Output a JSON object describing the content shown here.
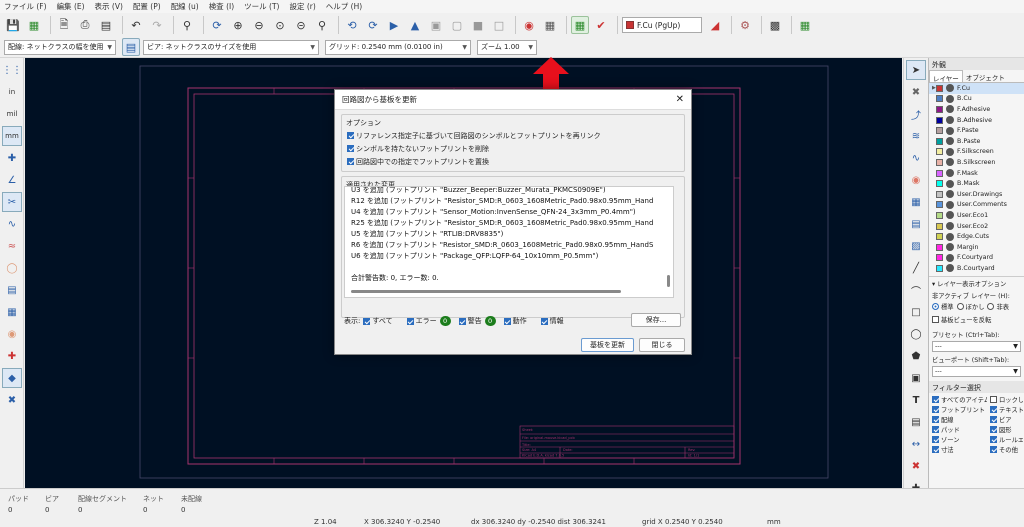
{
  "menu": [
    "ファイル (F)",
    "編集 (E)",
    "表示 (V)",
    "配置 (P)",
    "配線 (u)",
    "検査 (I)",
    "ツール (T)",
    "設定 (r)",
    "ヘルプ (H)"
  ],
  "toolbar": {
    "layer_select": "F.Cu (PgUp)",
    "icons": [
      "save-icon",
      "board-setup-icon",
      "new-icon",
      "print-icon",
      "plot-icon",
      "undo-icon",
      "redo-icon",
      "find-icon",
      "refresh-icon",
      "zoom-in-icon",
      "zoom-out-icon",
      "zoom-fit-icon",
      "zoom-objects-icon",
      "zoom-selection-icon",
      "rotate-ccw-icon",
      "rotate-cw-icon",
      "flip-icon",
      "mirror-icon",
      "group-icon",
      "ungroup-icon",
      "lock-icon",
      "unlock-icon",
      "netlist-icon",
      "footprint-library-icon",
      "update-pcb-icon",
      "drc-icon",
      "layer-pair-icon",
      "scripting-icon",
      "python-icon",
      "plugin-icon"
    ]
  },
  "toolbar2": {
    "track_width": "配線: ネットクラスの幅を使用",
    "via_size": "ビア: ネットクラスのサイズを使用",
    "grid": "グリッド: 0.2540 mm (0.0100 in)",
    "zoom": "ズーム 1.00"
  },
  "left_toolbar": [
    "grid-icon",
    "inch-icon",
    "mil-icon",
    "mm-icon",
    "cursor-icon",
    "polar-icon",
    "ratsnest-icon",
    "curved-ratsnest-icon",
    "track-outline-icon",
    "via-outline-icon",
    "pad-outline-icon",
    "zone-outline-icon",
    "zone-fill-icon",
    "highlight-net-icon",
    "layers-icon",
    "tool-icon"
  ],
  "left_toolbar_labels": {
    "inch": "in",
    "mil": "mil",
    "mm": "mm"
  },
  "right_toolbar": [
    "select-icon",
    "highlight-net-icon",
    "route-track-icon",
    "route-diff-pair-icon",
    "tune-length-icon",
    "add-footprint-icon",
    "add-via-icon",
    "add-zone-icon",
    "add-rule-area-icon",
    "add-line-icon",
    "add-arc-icon",
    "add-rectangle-icon",
    "add-circle-icon",
    "add-polygon-icon",
    "add-image-icon",
    "add-text-icon",
    "add-textbox-icon",
    "add-dimension-icon",
    "delete-icon",
    "set-origin-icon",
    "measure-icon"
  ],
  "appearance": {
    "title": "外観",
    "tabs": [
      "レイヤー",
      "オブジェクト"
    ],
    "layers": [
      {
        "name": "F.Cu",
        "color": "#c83434",
        "selected": true
      },
      {
        "name": "B.Cu",
        "color": "#4d7fc4"
      },
      {
        "name": "F.Adhesive",
        "color": "#8e1788"
      },
      {
        "name": "B.Adhesive",
        "color": "#00009e"
      },
      {
        "name": "F.Paste",
        "color": "#b4a0a0"
      },
      {
        "name": "B.Paste",
        "color": "#00a0a0"
      },
      {
        "name": "F.Silkscreen",
        "color": "#f2eda1"
      },
      {
        "name": "B.Silkscreen",
        "color": "#e8b2a7"
      },
      {
        "name": "F.Mask",
        "color": "#d864ff"
      },
      {
        "name": "B.Mask",
        "color": "#02ffee"
      },
      {
        "name": "User.Drawings",
        "color": "#c2c2c2"
      },
      {
        "name": "User.Comments",
        "color": "#5994dc"
      },
      {
        "name": "User.Eco1",
        "color": "#b4db88"
      },
      {
        "name": "User.Eco2",
        "color": "#d8c852"
      },
      {
        "name": "Edge.Cuts",
        "color": "#d0d254"
      },
      {
        "name": "Margin",
        "color": "#ff26e2"
      },
      {
        "name": "F.Courtyard",
        "color": "#ff26e2"
      },
      {
        "name": "B.Courtyard",
        "color": "#26e9ff"
      }
    ],
    "display_options": "レイヤー表示オプション",
    "inactive_label": "非アクティブ レイヤー (H):",
    "inactive_options": [
      "標準",
      "ぼかし",
      "非表"
    ],
    "flip_board": "基板ビューを反転",
    "presets_label": "プリセット (Ctrl+Tab):",
    "presets_value": "---",
    "viewports_label": "ビューポート (Shift+Tab):",
    "viewports_value": "---"
  },
  "filter": {
    "title": "フィルター選択",
    "items": [
      {
        "label": "すべてのアイテム",
        "checked": true
      },
      {
        "label": "ロックし",
        "checked": false
      },
      {
        "label": "フットプリント",
        "checked": true
      },
      {
        "label": "テキスト",
        "checked": true
      },
      {
        "label": "配線",
        "checked": true
      },
      {
        "label": "ビア",
        "checked": true
      },
      {
        "label": "パッド",
        "checked": true
      },
      {
        "label": "図形",
        "checked": true
      },
      {
        "label": "ゾーン",
        "checked": true
      },
      {
        "label": "ルールエ",
        "checked": true
      },
      {
        "label": "寸法",
        "checked": true
      },
      {
        "label": "その他",
        "checked": true
      }
    ]
  },
  "status": {
    "labels": [
      "パッド",
      "ビア",
      "配線セグメント",
      "ネット",
      "未配線"
    ],
    "values": [
      "0",
      "0",
      "0",
      "0",
      "0"
    ],
    "zoom": "Z 1.04",
    "xy": "X 306.3240  Y -0.2540",
    "dxdy": "dx 306.3240  dy -0.2540  dist 306.3241",
    "grid": "grid X 0.2540  Y 0.2540",
    "units": "mm"
  },
  "titleblock": {
    "sheet": "Sheet:",
    "file": "File: original-mouse.kicad_pcb",
    "title": "Title:",
    "size": "Size: A4",
    "date": "Date:",
    "rev": "Rev:",
    "kicad": "KiCad E.D.A.  kicad 7.0.5",
    "id": "Id: 1/1"
  },
  "dialog": {
    "title": "回路図から基板を更新",
    "options_title": "オプション",
    "options": [
      {
        "label": "リファレンス指定子に基づいて回路図のシンボルとフットプリントを再リンク",
        "checked": true
      },
      {
        "label": "シンボルを持たないフットプリントを削除",
        "checked": true
      },
      {
        "label": "回路図中での指定でフットプリントを置換",
        "checked": true
      }
    ],
    "changes_title": "適用された変更",
    "messages": [
      "U3 を追加 (フットプリント \"Buzzer_Beeper:Buzzer_Murata_PKMCS0909E\")",
      "R12 を追加 (フットプリント \"Resistor_SMD:R_0603_1608Metric_Pad0.98x0.95mm_Hand",
      "U4 を追加 (フットプリント \"Sensor_Motion:InvenSense_QFN-24_3x3mm_P0.4mm\")",
      "R25 を追加 (フットプリント \"Resistor_SMD:R_0603_1608Metric_Pad0.98x0.95mm_Hand",
      "U5 を追加 (フットプリント \"RTLIB:DRV8835\")",
      "R6 を追加 (フットプリント \"Resistor_SMD:R_0603_1608Metric_Pad0.98x0.95mm_HandS",
      "U6 を追加 (フットプリント \"Package_QFP:LQFP-64_10x10mm_P0.5mm\")",
      "",
      "合計警告数: 0, エラー数: 0."
    ],
    "show_label": "表示:",
    "filters": [
      {
        "label": "すべて",
        "checked": true
      },
      {
        "label": "エラー",
        "checked": true,
        "count": "0"
      },
      {
        "label": "警告",
        "checked": true,
        "count": "0"
      },
      {
        "label": "動作",
        "checked": true
      },
      {
        "label": "情報",
        "checked": true
      }
    ],
    "save_button": "保存...",
    "update_button": "基板を更新",
    "close_button": "閉じる"
  }
}
